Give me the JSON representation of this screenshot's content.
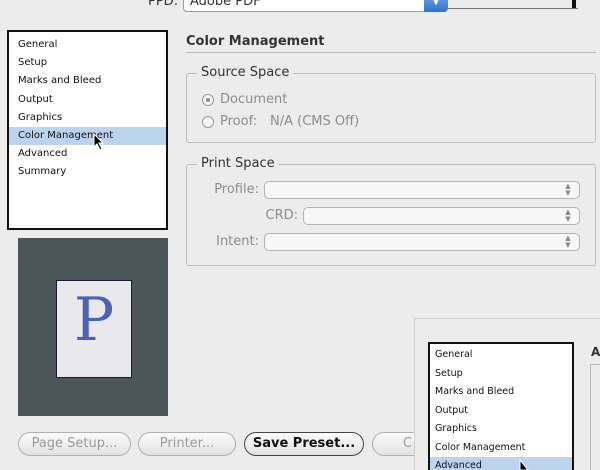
{
  "ppd": {
    "label": "PPD:",
    "value": "Adobe PDF"
  },
  "categories": {
    "items": [
      {
        "label": "General"
      },
      {
        "label": "Setup"
      },
      {
        "label": "Marks and Bleed"
      },
      {
        "label": "Output"
      },
      {
        "label": "Graphics"
      },
      {
        "label": "Color Management"
      },
      {
        "label": "Advanced"
      },
      {
        "label": "Summary"
      }
    ],
    "selected": "Color Management"
  },
  "preview": {
    "letter": "P"
  },
  "main": {
    "title": "Color Management",
    "source_space": {
      "title": "Source Space",
      "document_label": "Document",
      "proof_label": "Proof:",
      "proof_value": "N/A (CMS Off)",
      "selected": "Document"
    },
    "print_space": {
      "title": "Print Space",
      "profile_label": "Profile:",
      "crd_label": "CRD:",
      "intent_label": "Intent:"
    }
  },
  "buttons": {
    "page_setup": "Page Setup...",
    "printer": "Printer...",
    "save_preset": "Save Preset...",
    "partial": "C"
  },
  "overlay": {
    "items": [
      {
        "label": "General"
      },
      {
        "label": "Setup"
      },
      {
        "label": "Marks and Bleed"
      },
      {
        "label": "Output"
      },
      {
        "label": "Graphics"
      },
      {
        "label": "Color Management"
      },
      {
        "label": "Advanced"
      }
    ],
    "selected": "Advanced",
    "right_header": "A"
  },
  "colors": {
    "selection": "#bcd3ee",
    "preview_bg": "#4c5656",
    "letter": "#4a62b8"
  }
}
